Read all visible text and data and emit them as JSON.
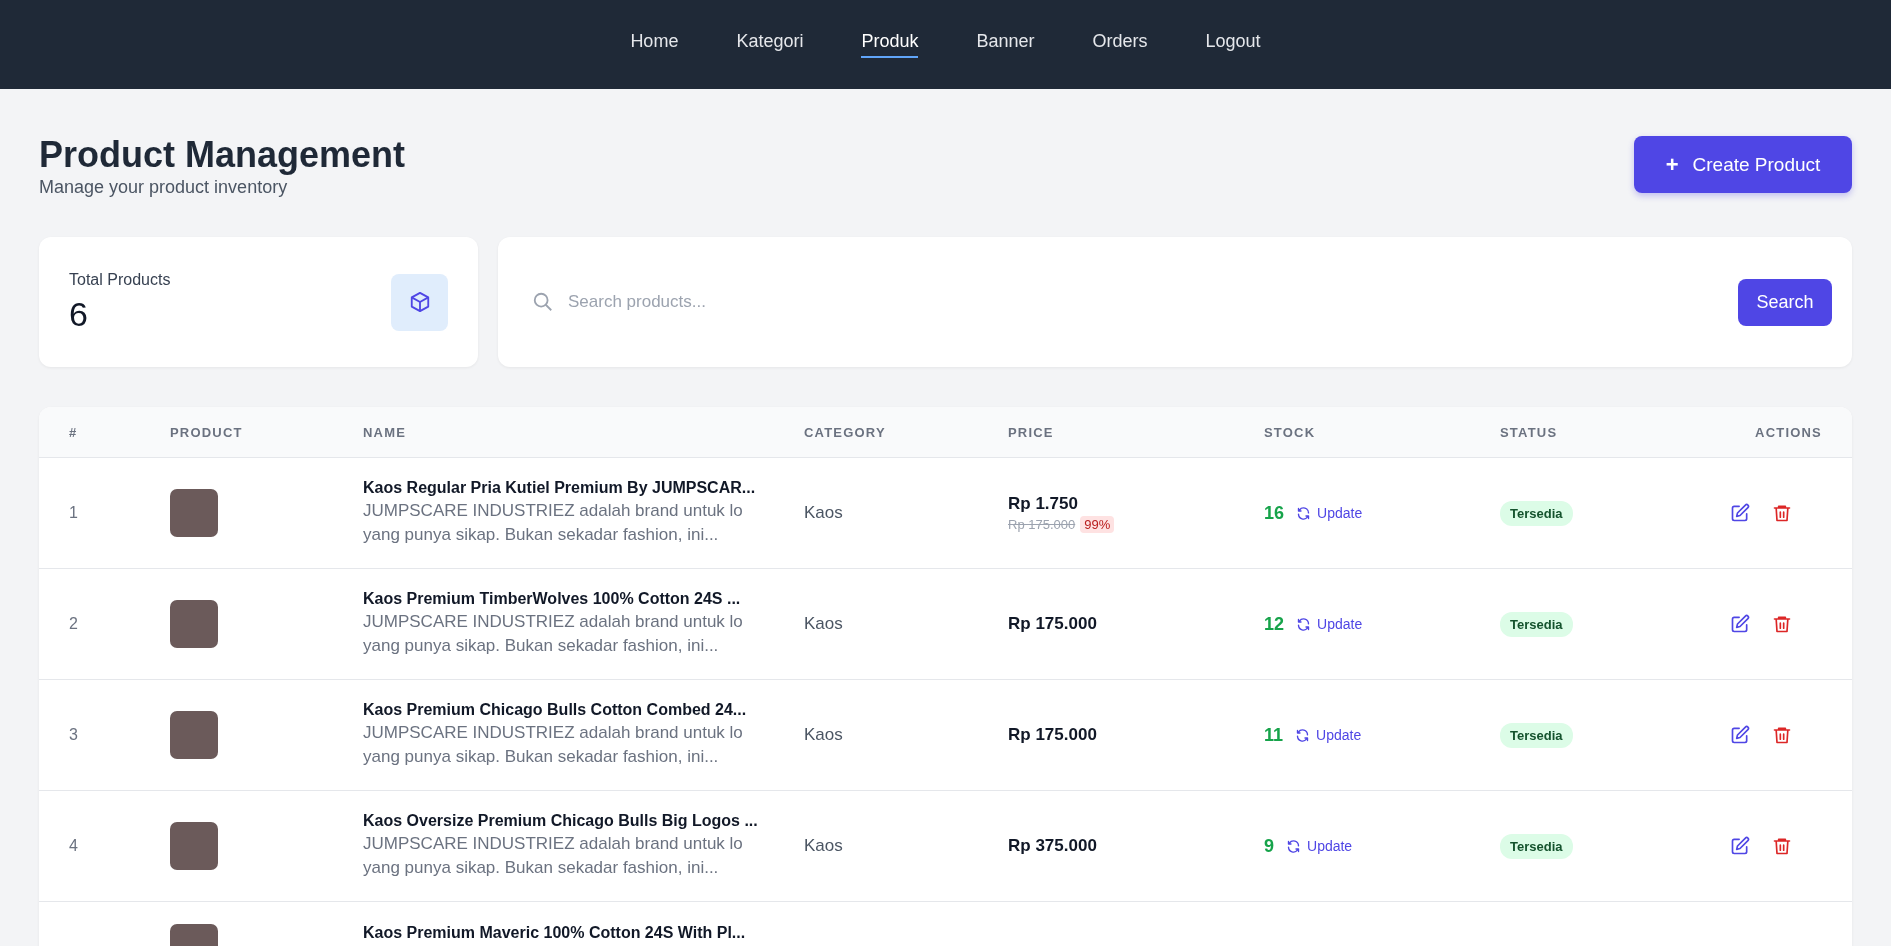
{
  "nav": [
    {
      "label": "Home",
      "selected": false
    },
    {
      "label": "Kategori",
      "selected": false
    },
    {
      "label": "Produk",
      "selected": true
    },
    {
      "label": "Banner",
      "selected": false
    },
    {
      "label": "Orders",
      "selected": false
    },
    {
      "label": "Logout",
      "selected": false
    }
  ],
  "header": {
    "title": "Product Management",
    "subtitle": "Manage your product inventory",
    "create_button": "Create Product",
    "create_icon": "+"
  },
  "stats": {
    "label": "Total Products",
    "value": "6"
  },
  "search": {
    "placeholder": "Search products...",
    "button": "Search"
  },
  "table": {
    "columns": [
      "#",
      "PRODUCT",
      "NAME",
      "CATEGORY",
      "PRICE",
      "STOCK",
      "STATUS",
      "ACTIONS"
    ],
    "rows": [
      {
        "number": "1",
        "name": "Kaos Regular Pria Kutiel Premium By JUMPSCAR...",
        "description": "JUMPSCARE INDUSTRIEZ adalah brand untuk lo\nyang punya sikap. Bukan sekadar fashion, ini...",
        "category": "Kaos",
        "price": "Rp 1.750",
        "original_price": "Rp 175.000",
        "discount": "99%",
        "stock": "16",
        "update": "Update",
        "status": "Tersedia"
      },
      {
        "number": "2",
        "name": "Kaos Premium TimberWolves 100% Cotton 24S ...",
        "description": "JUMPSCARE INDUSTRIEZ adalah brand untuk lo\nyang punya sikap. Bukan sekadar fashion, ini...",
        "category": "Kaos",
        "price": "Rp 175.000",
        "stock": "12",
        "update": "Update",
        "status": "Tersedia"
      },
      {
        "number": "3",
        "name": "Kaos Premium Chicago Bulls Cotton Combed 24...",
        "description": "JUMPSCARE INDUSTRIEZ adalah brand untuk lo\nyang punya sikap. Bukan sekadar fashion, ini...",
        "category": "Kaos",
        "price": "Rp 175.000",
        "stock": "11",
        "update": "Update",
        "status": "Tersedia"
      },
      {
        "number": "4",
        "name": "Kaos Oversize Premium Chicago Bulls Big Logos ...",
        "description": "JUMPSCARE INDUSTRIEZ adalah brand untuk lo\nyang punya sikap. Bukan sekadar fashion, ini...",
        "category": "Kaos",
        "price": "Rp 375.000",
        "stock": "9",
        "update": "Update",
        "status": "Tersedia"
      },
      {
        "name": "Kaos Premium Maveric 100% Cotton 24S With Pl..."
      }
    ]
  }
}
